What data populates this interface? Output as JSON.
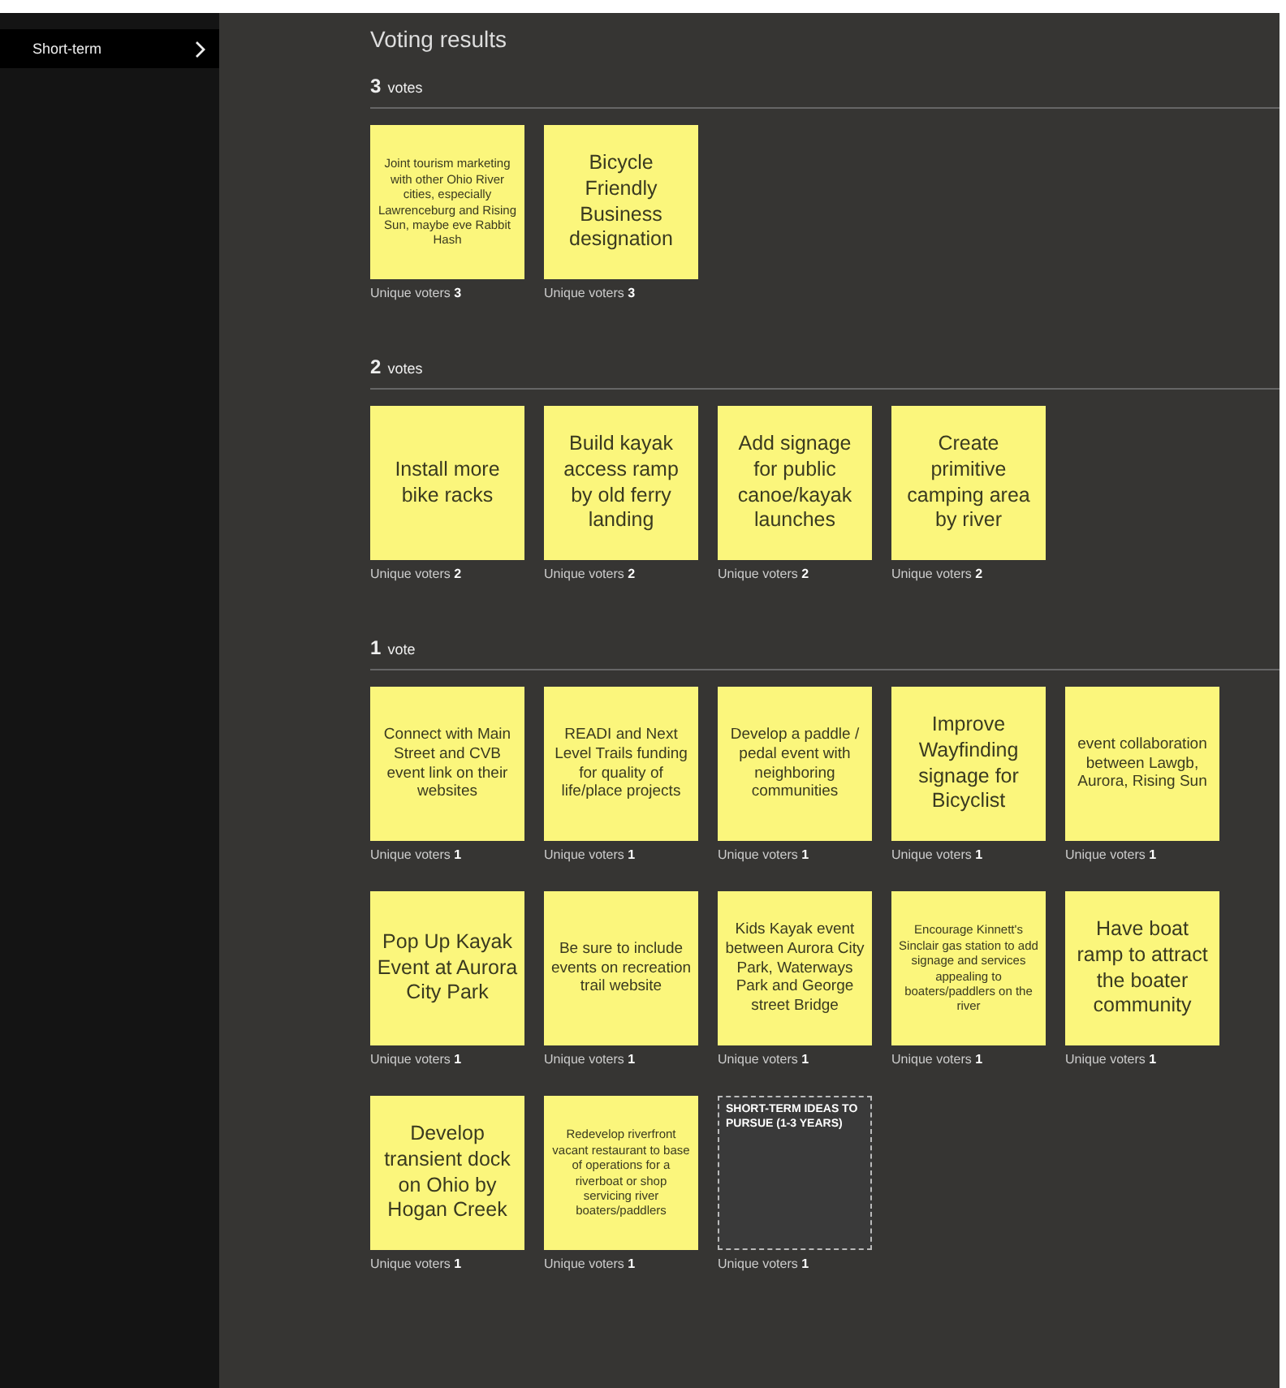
{
  "sidebar": {
    "items": [
      {
        "label": "Short-term",
        "selected": true
      }
    ]
  },
  "panel": {
    "title": "Voting results",
    "groups": [
      {
        "count": "3",
        "unit": "votes",
        "ideas": [
          {
            "kind": "sticky",
            "text": "Joint tourism marketing with other Ohio River cities, especially Lawrenceburg and Rising Sun, maybe eve Rabbit Hash",
            "voters_label": "Unique voters",
            "voters": "3"
          },
          {
            "kind": "sticky",
            "text": "Bicycle Friendly Business designation",
            "voters_label": "Unique voters",
            "voters": "3"
          }
        ]
      },
      {
        "count": "2",
        "unit": "votes",
        "ideas": [
          {
            "kind": "sticky",
            "text": "Install more bike racks",
            "voters_label": "Unique voters",
            "voters": "2"
          },
          {
            "kind": "sticky",
            "text": "Build kayak access ramp by old ferry landing",
            "voters_label": "Unique voters",
            "voters": "2"
          },
          {
            "kind": "sticky",
            "text": "Add signage for public canoe/kayak launches",
            "voters_label": "Unique voters",
            "voters": "2"
          },
          {
            "kind": "sticky",
            "text": "Create primitive camping area by river",
            "voters_label": "Unique voters",
            "voters": "2"
          }
        ]
      },
      {
        "count": "1",
        "unit": "vote",
        "ideas": [
          {
            "kind": "sticky",
            "text": "Connect with Main Street and CVB event link on their websites",
            "voters_label": "Unique voters",
            "voters": "1"
          },
          {
            "kind": "sticky",
            "text": "READI and Next Level Trails funding for quality of life/place projects",
            "voters_label": "Unique voters",
            "voters": "1"
          },
          {
            "kind": "sticky",
            "text": "Develop a paddle / pedal event with neighboring communities",
            "voters_label": "Unique voters",
            "voters": "1"
          },
          {
            "kind": "sticky",
            "text": "Improve Wayfinding signage for Bicyclist",
            "voters_label": "Unique voters",
            "voters": "1"
          },
          {
            "kind": "sticky",
            "text": "event collaboration between Lawgb, Aurora, Rising Sun",
            "voters_label": "Unique voters",
            "voters": "1"
          },
          {
            "kind": "sticky",
            "text": "Pop Up Kayak Event at Aurora City Park",
            "voters_label": "Unique voters",
            "voters": "1"
          },
          {
            "kind": "sticky",
            "text": "Be sure to include events on recreation trail website",
            "voters_label": "Unique voters",
            "voters": "1"
          },
          {
            "kind": "sticky",
            "text": "Kids Kayak event between Aurora City Park, Waterways Park and George street Bridge",
            "voters_label": "Unique voters",
            "voters": "1"
          },
          {
            "kind": "sticky",
            "text": "Encourage Kinnett's Sinclair gas station to add signage and services appealing to boaters/paddlers on the river",
            "voters_label": "Unique voters",
            "voters": "1"
          },
          {
            "kind": "sticky",
            "text": "Have boat ramp to attract the boater community",
            "voters_label": "Unique voters",
            "voters": "1"
          },
          {
            "kind": "sticky",
            "text": "Develop transient dock on Ohio by Hogan Creek",
            "voters_label": "Unique voters",
            "voters": "1"
          },
          {
            "kind": "sticky",
            "text": "Redevelop riverfront vacant restaurant to base of operations for a riverboat or shop servicing river boaters/paddlers",
            "voters_label": "Unique voters",
            "voters": "1"
          },
          {
            "kind": "section",
            "text": "SHORT-TERM IDEAS TO PURSUE (1-3 YEARS)",
            "voters_label": "Unique voters",
            "voters": "1"
          }
        ]
      }
    ]
  }
}
